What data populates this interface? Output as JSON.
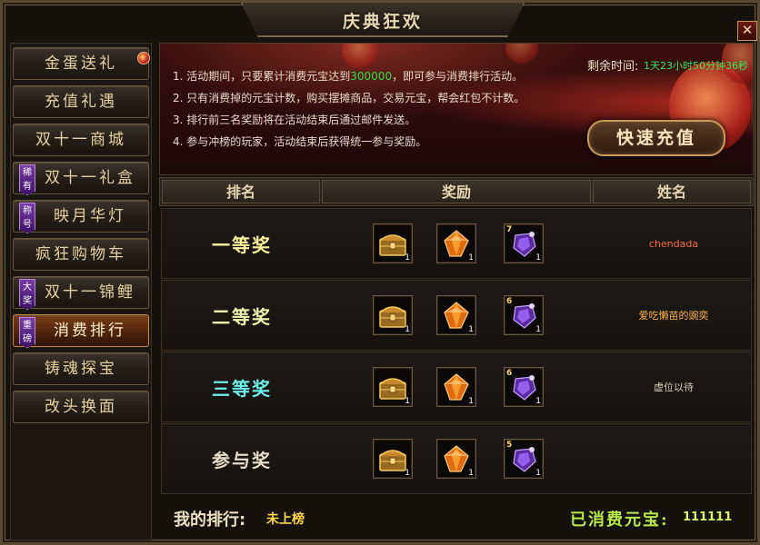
{
  "window": {
    "title": "庆典狂欢",
    "close_label": "✕"
  },
  "sidebar": {
    "items": [
      {
        "label": "金蛋送礼",
        "badge": "",
        "active": false,
        "dot": true
      },
      {
        "label": "充值礼遇",
        "badge": "",
        "active": false
      },
      {
        "label": "双十一商城",
        "badge": "",
        "active": false
      },
      {
        "label": "双十一礼盒",
        "badge": "稀有",
        "active": false
      },
      {
        "label": "映月华灯",
        "badge": "称号",
        "active": false
      },
      {
        "label": "疯狂购物车",
        "badge": "",
        "active": false
      },
      {
        "label": "双十一锦鲤",
        "badge": "大奖",
        "active": false
      },
      {
        "label": "消费排行",
        "badge": "重磅",
        "active": true
      },
      {
        "label": "铸魂探宝",
        "badge": "",
        "active": false
      },
      {
        "label": "改头换面",
        "badge": "",
        "active": false
      }
    ]
  },
  "banner": {
    "rules": [
      {
        "prefix": "1. 活动期间，只要累计消费元宝达到",
        "highlight": "300000",
        "suffix": "，即可参与消费排行活动。"
      },
      {
        "prefix": "2. 只有消费掉的元宝计数，购买摆摊商品，交易元宝，帮会红包不计数。",
        "highlight": "",
        "suffix": ""
      },
      {
        "prefix": "3. 排行前三名奖励将在活动结束后通过邮件发送。",
        "highlight": "",
        "suffix": ""
      },
      {
        "prefix": "4. 参与冲榜的玩家，活动结束后获得统一参与奖励。",
        "highlight": "",
        "suffix": ""
      }
    ],
    "timer_label": "剩余时间:",
    "timer_value": "1天23小时50分钟36秒",
    "quick_recharge_label": "快速充值"
  },
  "table": {
    "headers": [
      "排名",
      "奖励",
      "姓名"
    ],
    "rows": [
      {
        "rank": "一等奖",
        "rank_color": "#fff3a0",
        "name": "chendada",
        "name_color": "#ff6a3a",
        "items": [
          {
            "icon": "chest-icon",
            "qty": "1",
            "lvl": ""
          },
          {
            "icon": "gem-icon",
            "qty": "1",
            "lvl": ""
          },
          {
            "icon": "purple-crystal-icon",
            "qty": "1",
            "lvl": "7"
          }
        ]
      },
      {
        "rank": "二等奖",
        "rank_color": "#eef7b0",
        "name": "爱吃懒苗的豌奕",
        "name_color": "#ffb24a",
        "items": [
          {
            "icon": "chest-icon",
            "qty": "1",
            "lvl": ""
          },
          {
            "icon": "gem-icon",
            "qty": "1",
            "lvl": ""
          },
          {
            "icon": "purple-crystal-icon",
            "qty": "1",
            "lvl": "6"
          }
        ]
      },
      {
        "rank": "三等奖",
        "rank_color": "#6ff0e8",
        "name": "虚位以待",
        "name_color": "#d8cdb8",
        "items": [
          {
            "icon": "chest-icon",
            "qty": "1",
            "lvl": ""
          },
          {
            "icon": "gem-icon",
            "qty": "1",
            "lvl": ""
          },
          {
            "icon": "purple-crystal-icon",
            "qty": "1",
            "lvl": "6"
          }
        ]
      },
      {
        "rank": "参与奖",
        "rank_color": "#e6dcc8",
        "name": "",
        "name_color": "#d8cdb8",
        "items": [
          {
            "icon": "chest-icon",
            "qty": "1",
            "lvl": ""
          },
          {
            "icon": "gem-icon",
            "qty": "1",
            "lvl": ""
          },
          {
            "icon": "purple-crystal-icon",
            "qty": "1",
            "lvl": "5"
          }
        ]
      }
    ]
  },
  "footer": {
    "my_rank_label": "我的排行:",
    "my_rank_value": "未上榜",
    "spent_label": "已消费元宝:",
    "spent_value": "111111"
  }
}
